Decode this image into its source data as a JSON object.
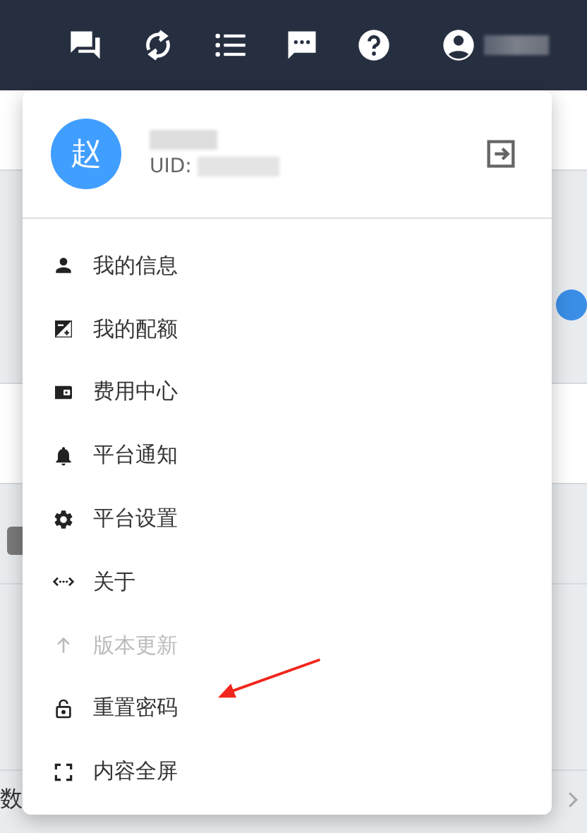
{
  "header": {
    "icons": [
      {
        "kind": "chat"
      },
      {
        "kind": "sync"
      },
      {
        "kind": "list"
      },
      {
        "kind": "message"
      },
      {
        "kind": "help"
      },
      {
        "kind": "account"
      }
    ]
  },
  "user_menu": {
    "avatar": "赵",
    "uid_label": "UID:",
    "items": [
      {
        "kind": "person",
        "label": "我的信息",
        "disabled": false
      },
      {
        "kind": "quota",
        "label": "我的配额",
        "disabled": false
      },
      {
        "kind": "wallet",
        "label": "费用中心",
        "disabled": false
      },
      {
        "kind": "bell",
        "label": "平台通知",
        "disabled": false
      },
      {
        "kind": "gear",
        "label": "平台设置",
        "disabled": false
      },
      {
        "kind": "code",
        "label": "关于",
        "disabled": false
      },
      {
        "kind": "up",
        "label": "版本更新",
        "disabled": true
      },
      {
        "kind": "lock",
        "label": "重置密码",
        "disabled": false
      },
      {
        "kind": "fullscreen",
        "label": "内容全屏",
        "disabled": false
      }
    ]
  },
  "pager": {
    "label": "数"
  }
}
